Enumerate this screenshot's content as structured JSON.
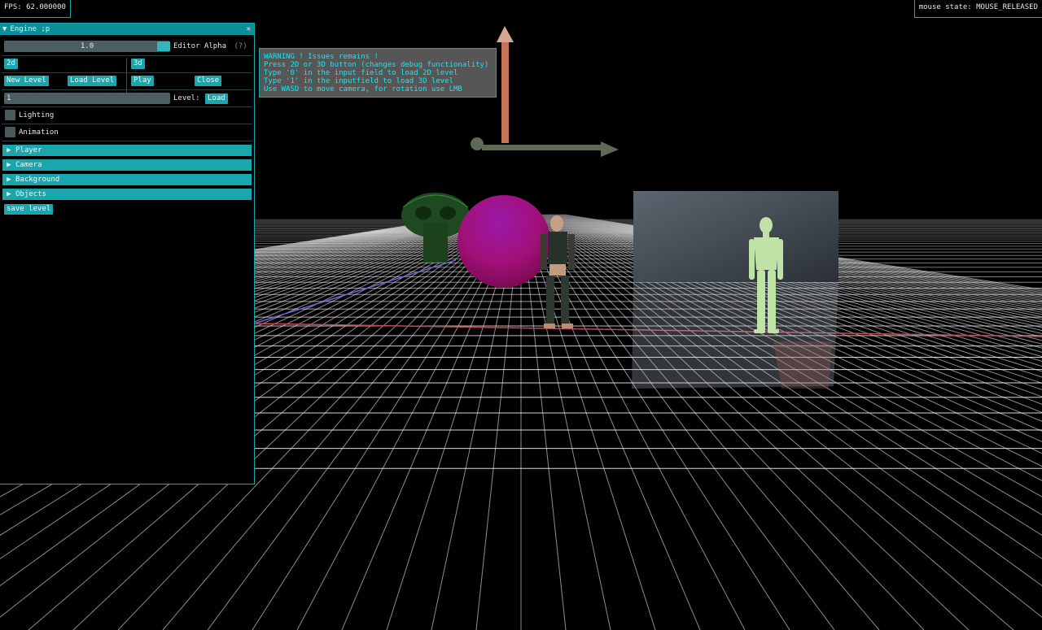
{
  "hud": {
    "fps_text": "FPS: 62.000000",
    "mouse_state_text": "mouse state: MOUSE_RELEASED"
  },
  "editor": {
    "title": "Engine ;p",
    "collapse_icon": "triangle-down-icon",
    "close_icon": "close-icon",
    "close_glyph": "✕",
    "alpha_slider_value": "1.0",
    "alpha_slider_fraction": 1.0,
    "alpha_label": "Editor Alpha",
    "help_marker": "(?)",
    "btn_2d": "2d",
    "btn_3d": "3d",
    "btn_new_level": "New Level",
    "btn_load_level": "Load Level",
    "btn_play": "Play",
    "btn_close": "Close",
    "level_input_value": "1",
    "level_label": "Level:",
    "btn_load": "Load",
    "lighting_label": "Lighting",
    "lighting_checked": false,
    "animation_label": "Animation",
    "animation_checked": false,
    "sections": [
      {
        "label": "Player"
      },
      {
        "label": "Camera"
      },
      {
        "label": "Background"
      },
      {
        "label": "Objects"
      }
    ],
    "btn_save_level": "save level"
  },
  "warning": {
    "lines": [
      "WARNING ! Issues remains !",
      "Press 2D or 3D button (changes debug functionality)",
      "Type '0' in the input field to load 2D level",
      "Type '1' in the inputfield to load 3D level",
      "Use WASD to move camera, for rotation use LMB"
    ]
  },
  "colors": {
    "accent": "#1aa6ad",
    "sphere": "#a0107a",
    "warning_text": "#00f0ff"
  }
}
